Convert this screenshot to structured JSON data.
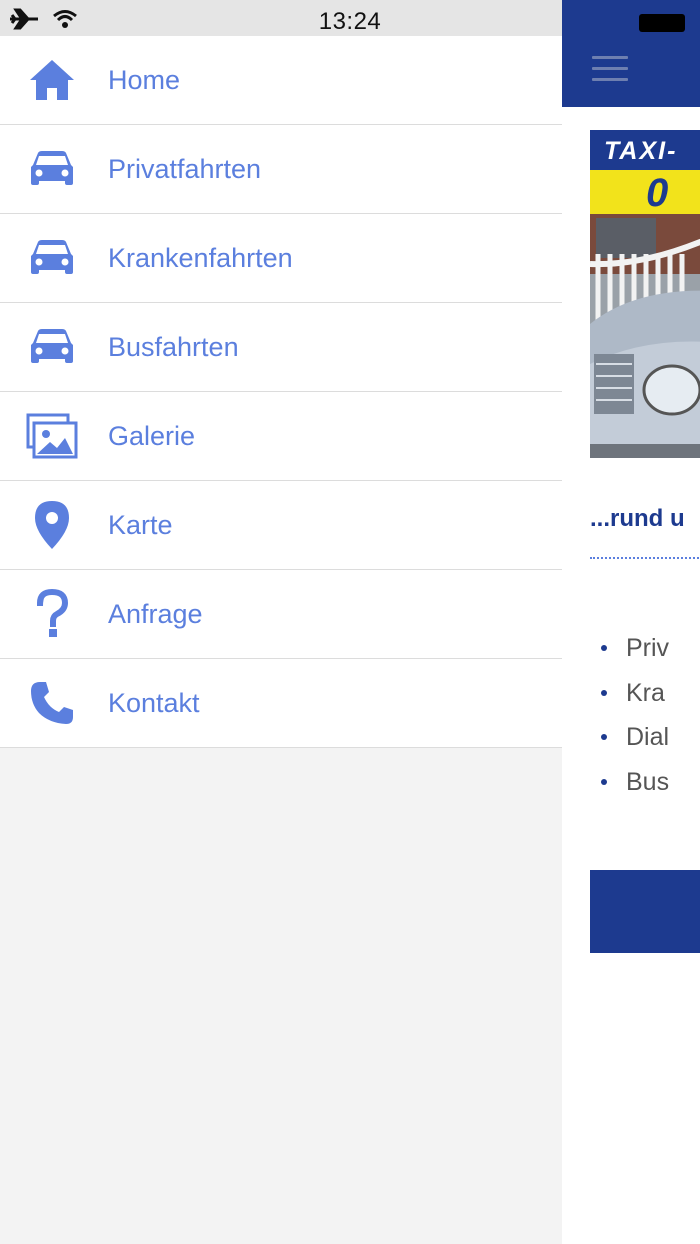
{
  "status_bar": {
    "time": "13:24"
  },
  "menu": {
    "items": [
      {
        "label": "Home",
        "icon": "home-icon"
      },
      {
        "label": "Privatfahrten",
        "icon": "car-icon"
      },
      {
        "label": "Krankenfahrten",
        "icon": "car-icon"
      },
      {
        "label": "Busfahrten",
        "icon": "car-icon"
      },
      {
        "label": "Galerie",
        "icon": "gallery-icon"
      },
      {
        "label": "Karte",
        "icon": "map-pin-icon"
      },
      {
        "label": "Anfrage",
        "icon": "question-icon"
      },
      {
        "label": "Kontakt",
        "icon": "phone-icon"
      }
    ]
  },
  "content": {
    "banner_top": "TAXI-",
    "banner_number": "0",
    "tagline": "...rund u",
    "services": [
      "Priv",
      "Kra",
      "Dial",
      "Bus"
    ]
  },
  "colors": {
    "accent_blue": "#1d3a8f",
    "menu_icon_blue": "#5b7fde",
    "banner_yellow": "#f2e31b"
  }
}
